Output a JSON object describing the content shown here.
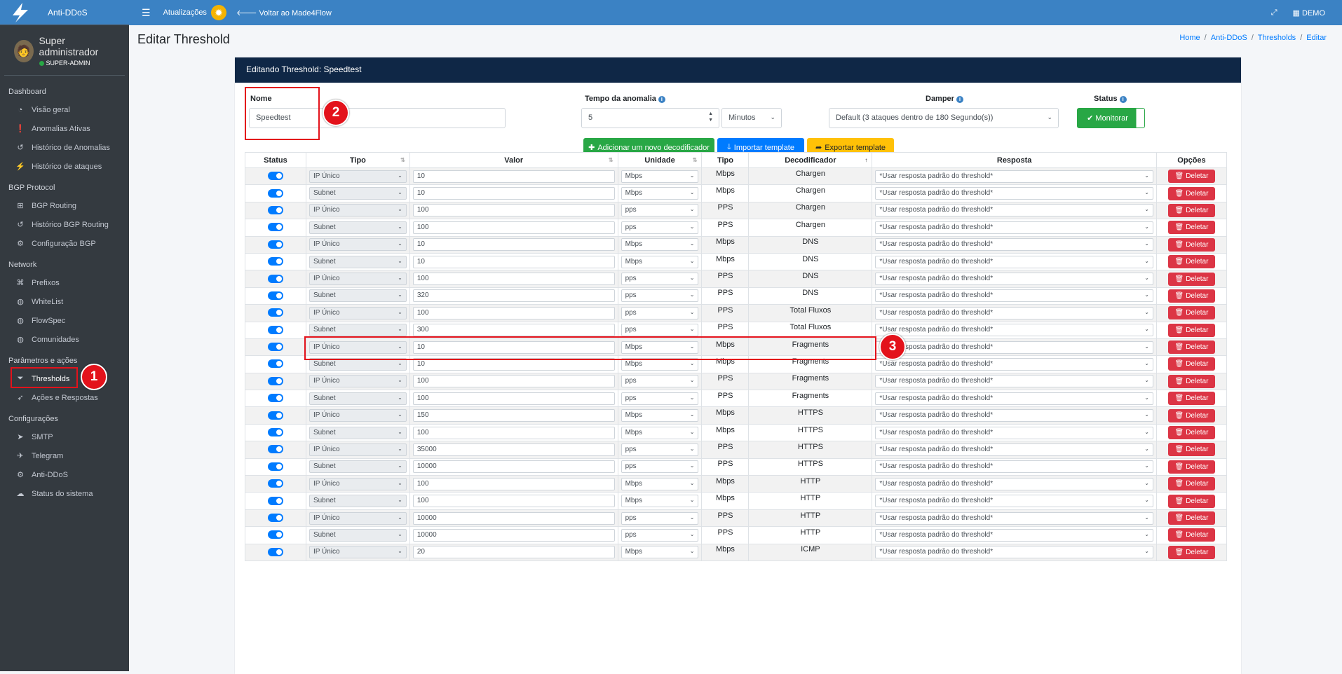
{
  "brand": {
    "name": "Anti-DDoS"
  },
  "user": {
    "name": "Super administrador",
    "role": "SUPER-ADMIN"
  },
  "sidebar": {
    "sections": [
      {
        "header": "Dashboard",
        "items": [
          {
            "label": "Visão geral",
            "icon": "dashboard-icon"
          },
          {
            "label": "Anomalias Ativas",
            "icon": "exclamation-circle-icon"
          },
          {
            "label": "Histórico de Anomalias",
            "icon": "history-icon"
          },
          {
            "label": "Histórico de ataques",
            "icon": "bolt-icon"
          }
        ]
      },
      {
        "header": "BGP Protocol",
        "items": [
          {
            "label": "BGP Routing",
            "icon": "network-icon"
          },
          {
            "label": "Histórico BGP Routing",
            "icon": "history-icon"
          },
          {
            "label": "Configuração BGP",
            "icon": "gear-icon"
          }
        ]
      },
      {
        "header": "Network",
        "items": [
          {
            "label": "Prefixos",
            "icon": "sitemap-icon"
          },
          {
            "label": "WhiteList",
            "icon": "globe-icon"
          },
          {
            "label": "FlowSpec",
            "icon": "globe-icon"
          },
          {
            "label": "Comunidades",
            "icon": "globe-icon"
          }
        ]
      },
      {
        "header": "Parâmetros e ações",
        "items": [
          {
            "label": "Thresholds",
            "icon": "filter-icon"
          },
          {
            "label": "Ações e Respostas",
            "icon": "rocket-icon"
          }
        ]
      },
      {
        "header": "Configurações",
        "items": [
          {
            "label": "SMTP",
            "icon": "send-icon"
          },
          {
            "label": "Telegram",
            "icon": "telegram-icon"
          },
          {
            "label": "Anti-DDoS",
            "icon": "gears-icon"
          },
          {
            "label": "Status do sistema",
            "icon": "cloud-icon"
          }
        ]
      }
    ]
  },
  "topbar": {
    "updates": "Atualizações",
    "back": "Voltar ao Made4Flow",
    "account": "DEMO"
  },
  "page": {
    "title": "Editar Threshold"
  },
  "breadcrumb": [
    "Home",
    "Anti-DDoS",
    "Thresholds",
    "Editar"
  ],
  "card": {
    "title": "Editando Threshold: Speedtest"
  },
  "form": {
    "name_label": "Nome",
    "name_value": "Speedtest",
    "time_label": "Tempo da anomalia",
    "time_value": "5",
    "time_unit": "Minutos",
    "damper_label": "Damper",
    "damper_value": "Default (3 ataques dentro de 180 Segundo(s))",
    "status_label": "Status",
    "status_button": "Monitorar"
  },
  "actions": {
    "add": "Adicionar um novo decodificador",
    "import": "Importar template",
    "export": "Exportar template"
  },
  "table": {
    "headers": [
      "Status",
      "Tipo",
      "Valor",
      "Unidade",
      "Tipo",
      "Decodificador",
      "Resposta",
      "Opções"
    ],
    "response_default": "*Usar resposta padrão do threshold*",
    "delete_label": "Deletar",
    "rows": [
      {
        "tipo": "IP Único",
        "valor": "10",
        "unidade": "Mbps",
        "tipo2": "Mbps",
        "dec": "Chargen"
      },
      {
        "tipo": "Subnet",
        "valor": "10",
        "unidade": "Mbps",
        "tipo2": "Mbps",
        "dec": "Chargen"
      },
      {
        "tipo": "IP Único",
        "valor": "100",
        "unidade": "pps",
        "tipo2": "PPS",
        "dec": "Chargen"
      },
      {
        "tipo": "Subnet",
        "valor": "100",
        "unidade": "pps",
        "tipo2": "PPS",
        "dec": "Chargen"
      },
      {
        "tipo": "IP Único",
        "valor": "10",
        "unidade": "Mbps",
        "tipo2": "Mbps",
        "dec": "DNS"
      },
      {
        "tipo": "Subnet",
        "valor": "10",
        "unidade": "Mbps",
        "tipo2": "Mbps",
        "dec": "DNS"
      },
      {
        "tipo": "IP Único",
        "valor": "100",
        "unidade": "pps",
        "tipo2": "PPS",
        "dec": "DNS"
      },
      {
        "tipo": "Subnet",
        "valor": "320",
        "unidade": "pps",
        "tipo2": "PPS",
        "dec": "DNS"
      },
      {
        "tipo": "IP Único",
        "valor": "100",
        "unidade": "pps",
        "tipo2": "PPS",
        "dec": "Total Fluxos"
      },
      {
        "tipo": "Subnet",
        "valor": "300",
        "unidade": "pps",
        "tipo2": "PPS",
        "dec": "Total Fluxos"
      },
      {
        "tipo": "IP Único",
        "valor": "10",
        "unidade": "Mbps",
        "tipo2": "Mbps",
        "dec": "Fragments"
      },
      {
        "tipo": "Subnet",
        "valor": "10",
        "unidade": "Mbps",
        "tipo2": "Mbps",
        "dec": "Fragments"
      },
      {
        "tipo": "IP Único",
        "valor": "100",
        "unidade": "pps",
        "tipo2": "PPS",
        "dec": "Fragments"
      },
      {
        "tipo": "Subnet",
        "valor": "100",
        "unidade": "pps",
        "tipo2": "PPS",
        "dec": "Fragments"
      },
      {
        "tipo": "IP Único",
        "valor": "150",
        "unidade": "Mbps",
        "tipo2": "Mbps",
        "dec": "HTTPS"
      },
      {
        "tipo": "Subnet",
        "valor": "100",
        "unidade": "Mbps",
        "tipo2": "Mbps",
        "dec": "HTTPS"
      },
      {
        "tipo": "IP Único",
        "valor": "35000",
        "unidade": "pps",
        "tipo2": "PPS",
        "dec": "HTTPS"
      },
      {
        "tipo": "Subnet",
        "valor": "10000",
        "unidade": "pps",
        "tipo2": "PPS",
        "dec": "HTTPS"
      },
      {
        "tipo": "IP Único",
        "valor": "100",
        "unidade": "Mbps",
        "tipo2": "Mbps",
        "dec": "HTTP"
      },
      {
        "tipo": "Subnet",
        "valor": "100",
        "unidade": "Mbps",
        "tipo2": "Mbps",
        "dec": "HTTP"
      },
      {
        "tipo": "IP Único",
        "valor": "10000",
        "unidade": "pps",
        "tipo2": "PPS",
        "dec": "HTTP"
      },
      {
        "tipo": "Subnet",
        "valor": "10000",
        "unidade": "pps",
        "tipo2": "PPS",
        "dec": "HTTP"
      },
      {
        "tipo": "IP Único",
        "valor": "20",
        "unidade": "Mbps",
        "tipo2": "Mbps",
        "dec": "ICMP"
      }
    ]
  },
  "annotations": [
    "1",
    "2",
    "3"
  ],
  "colors": {
    "topbar": "#3b82c4",
    "sidebar": "#343a40",
    "card_header": "#0f2746",
    "annotation": "#e3121b"
  }
}
